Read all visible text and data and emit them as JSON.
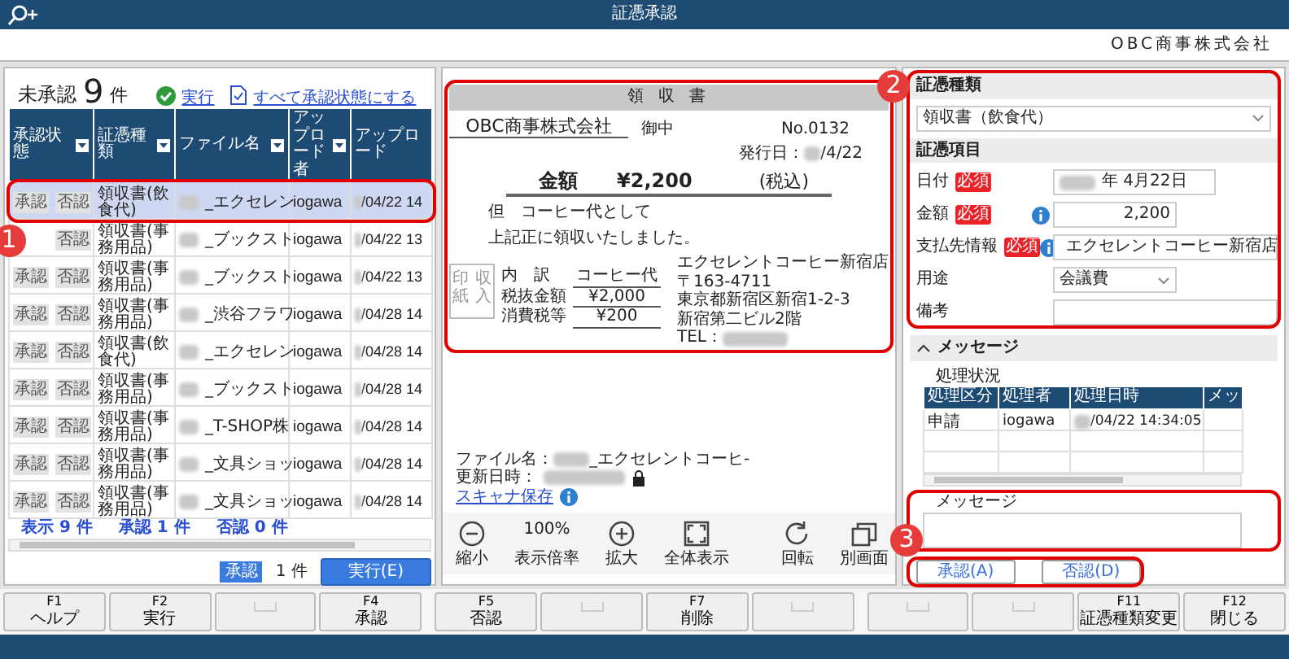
{
  "window": {
    "title": "証憑承認"
  },
  "company": "OBC商事株式会社",
  "pending": {
    "label": "未承認",
    "count": "9",
    "unit": "件"
  },
  "actions": [
    {
      "kind": "run",
      "label": "実行"
    },
    {
      "kind": "approve_all",
      "label": "すべて承認状態にする"
    }
  ],
  "table": {
    "columns": [
      "承認状態",
      "証憑種類",
      "ファイル名",
      "アップロード者",
      "アップロード"
    ],
    "rows": [
      {
        "approve": "承認",
        "reject": "否認",
        "type": "領収書(飲食代)",
        "file": "_エクセレン",
        "uploader": "iogawa",
        "date": "/04/22 14",
        "redacted": true,
        "selected": true
      },
      {
        "reject": "否認",
        "type": "領収書(事務用品)",
        "file": "_ブックスト",
        "uploader": "iogawa",
        "date": "/04/22 13",
        "redacted": true,
        "selected": false
      },
      {
        "approve": "承認",
        "reject": "否認",
        "type": "領収書(事務用品)",
        "file": "_ブックスト",
        "uploader": "iogawa",
        "date": "/04/22 13",
        "redacted": true,
        "selected": false
      },
      {
        "approve": "承認",
        "reject": "否認",
        "type": "領収書(事務用品)",
        "file": "_渋谷フラワ",
        "uploader": "iogawa",
        "date": "/04/28 14",
        "redacted": true,
        "selected": false
      },
      {
        "approve": "承認",
        "reject": "否認",
        "type": "領収書(飲食代)",
        "file": "_エクセレン",
        "uploader": "iogawa",
        "date": "/04/28 14",
        "redacted": true,
        "selected": false
      },
      {
        "approve": "承認",
        "reject": "否認",
        "type": "領収書(事務用品)",
        "file": "_ブックスト",
        "uploader": "iogawa",
        "date": "/04/28 14",
        "redacted": true,
        "selected": false
      },
      {
        "approve": "承認",
        "reject": "否認",
        "type": "領収書(事務用品)",
        "file": "_T-SHOP株",
        "uploader": "iogawa",
        "date": "/04/28 14",
        "redacted": true,
        "selected": false
      },
      {
        "approve": "承認",
        "reject": "否認",
        "type": "領収書(事務用品)",
        "file": "_文具ショッ",
        "uploader": "iogawa",
        "date": "/04/28 14",
        "redacted": true,
        "selected": false
      },
      {
        "approve": "承認",
        "reject": "否認",
        "type": "領収書(事務用品)",
        "file": "_文具ショッ",
        "uploader": "iogawa",
        "date": "/04/28 14",
        "redacted": true,
        "selected": false
      }
    ]
  },
  "summary": [
    "表示 9 件",
    "承認 1 件",
    "否認 0 件"
  ],
  "execute_bar": {
    "badge": "承認",
    "count": "1 件",
    "button": "実行(E)"
  },
  "receipt": {
    "title": "領 収 書",
    "addressee": "OBC商事株式会社",
    "honorific": "御中",
    "number": "No.0132",
    "issue_label": "発行日：",
    "issue_date": "/4/22",
    "amount_label": "金額",
    "amount": "¥2,200",
    "tax_note": "(税込)",
    "purpose": "但　コーヒー代として",
    "statement": "上記正に領収いたしました。",
    "stamp": [
      "印紙",
      "収入"
    ],
    "breakdown": [
      {
        "label": "内　訳",
        "value": "コーヒー代"
      },
      {
        "label": "税抜金額",
        "value": "¥2,000"
      },
      {
        "label": "消費税等",
        "value": "¥200"
      }
    ],
    "shop": [
      "エクセレントコーヒー新宿店",
      "〒163-4711",
      "東京都新宿区新宿1-2-3",
      "新宿第二ビル2階",
      "TEL："
    ]
  },
  "file_info": {
    "file_label": "ファイル名：",
    "file_name": "_エクセレントコーヒ-",
    "updated_label": "更新日時：",
    "link": "スキャナ保存"
  },
  "viewer_toolbar": {
    "left": [
      {
        "kind": "zoom_out",
        "label": "縮小"
      },
      {
        "kind": "zoom_level",
        "value": "100%",
        "label": "表示倍率"
      },
      {
        "kind": "zoom_in",
        "label": "拡大"
      },
      {
        "kind": "fit",
        "label": "全体表示"
      }
    ],
    "right": [
      {
        "kind": "rotate",
        "label": "回転"
      },
      {
        "kind": "window",
        "label": "別画面"
      }
    ]
  },
  "form": {
    "type_heading": "証憑種類",
    "type_value": "領収書（飲食代）",
    "items_heading": "証憑項目",
    "fields": [
      {
        "kind": "text",
        "label": "日付",
        "required_badge": "必須",
        "info": false,
        "value": "年 4月22日",
        "redacted": true
      },
      {
        "kind": "number",
        "label": "金額",
        "required_badge": "必須",
        "info": true,
        "value": "2,200",
        "redacted": false
      },
      {
        "kind": "text",
        "label": "支払先情報",
        "required_badge": "必須",
        "info": true,
        "value": "エクセレントコーヒー新宿店",
        "redacted": false
      },
      {
        "kind": "select",
        "label": "用途",
        "info": false,
        "value": "会議費",
        "redacted": false
      },
      {
        "kind": "text",
        "label": "備考",
        "info": false,
        "redacted": false
      }
    ]
  },
  "messages": {
    "heading": "メッセージ",
    "expanded": true,
    "status_label": "処理状況",
    "columns": [
      "処理区分",
      "処理者",
      "処理日時",
      "メッ"
    ],
    "rows": [
      {
        "type": "申請",
        "user": "iogawa",
        "time": "/04/22 14:34:05",
        "redacted": true
      }
    ],
    "message_label": "メッセージ"
  },
  "decision_buttons": [
    "承認(A)",
    "否認(D)"
  ],
  "function_keys": [
    {
      "kind": "key",
      "key": "F1",
      "label": "ヘルプ"
    },
    {
      "kind": "key",
      "key": "F2",
      "label": "実行"
    },
    {
      "kind": "empty"
    },
    {
      "kind": "key",
      "key": "F4",
      "label": "承認"
    },
    {
      "kind": "key",
      "key": "F5",
      "label": "否認"
    },
    {
      "kind": "empty"
    },
    {
      "kind": "key",
      "key": "F7",
      "label": "削除"
    },
    {
      "kind": "empty"
    },
    {
      "kind": "empty"
    },
    {
      "kind": "empty"
    },
    {
      "kind": "key",
      "key": "F11",
      "label": "証憑種類変更"
    },
    {
      "kind": "key",
      "key": "F12",
      "label": "閉じる"
    }
  ],
  "annotations": [
    "1",
    "2",
    "3"
  ]
}
